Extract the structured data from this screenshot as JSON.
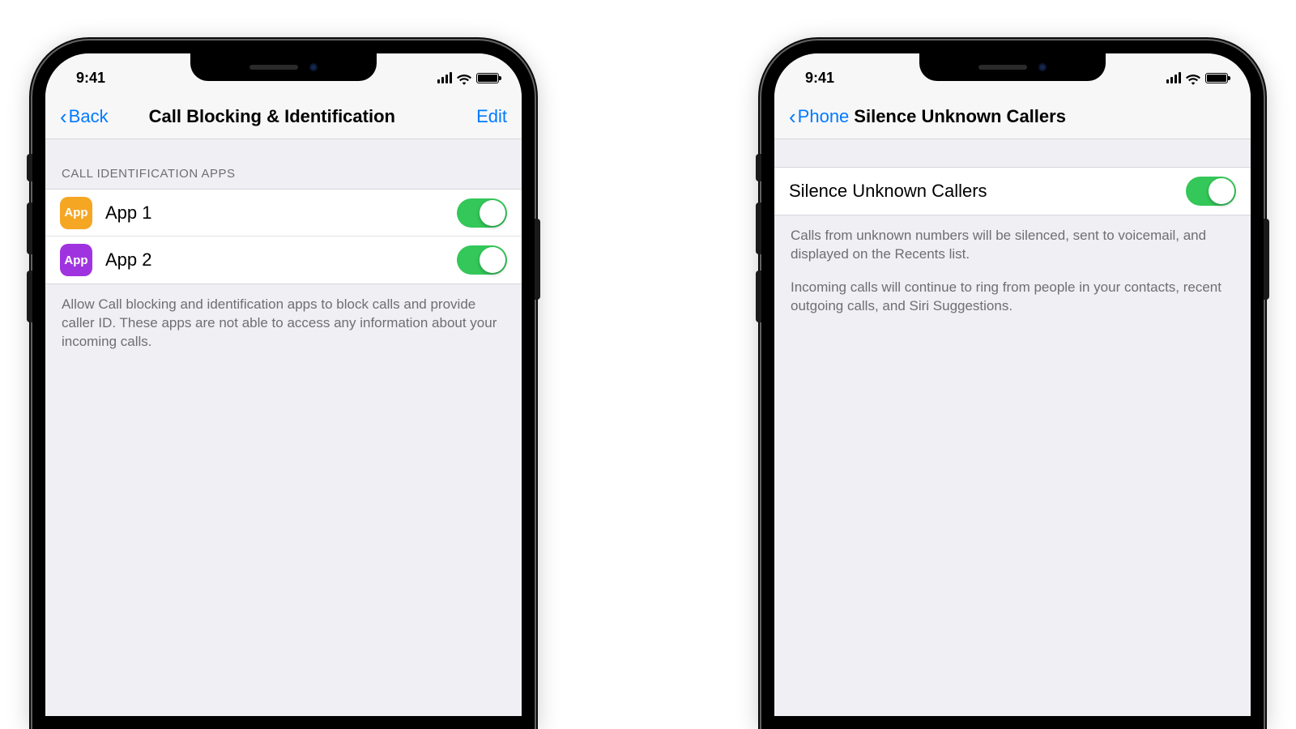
{
  "statusbar": {
    "time": "9:41"
  },
  "phone_left": {
    "nav": {
      "back_label": "Back",
      "title": "Call Blocking & Identification",
      "edit_label": "Edit"
    },
    "section_header": "CALL IDENTIFICATION APPS",
    "apps": [
      {
        "icon_text": "App",
        "icon_color": "orange",
        "name": "App 1",
        "enabled": true
      },
      {
        "icon_text": "App",
        "icon_color": "purple",
        "name": "App 2",
        "enabled": true
      }
    ],
    "footer": "Allow Call blocking and identification apps to block calls and provide caller ID. These apps are not able to access any information about your incoming calls."
  },
  "phone_right": {
    "nav": {
      "back_label": "Phone",
      "title": "Silence Unknown Callers"
    },
    "row_label": "Silence Unknown Callers",
    "row_enabled": true,
    "footer_p1": "Calls from unknown numbers will be silenced, sent to voicemail, and displayed on the Recents list.",
    "footer_p2": "Incoming calls will continue to ring from people in your contacts, recent outgoing calls, and Siri Suggestions."
  }
}
